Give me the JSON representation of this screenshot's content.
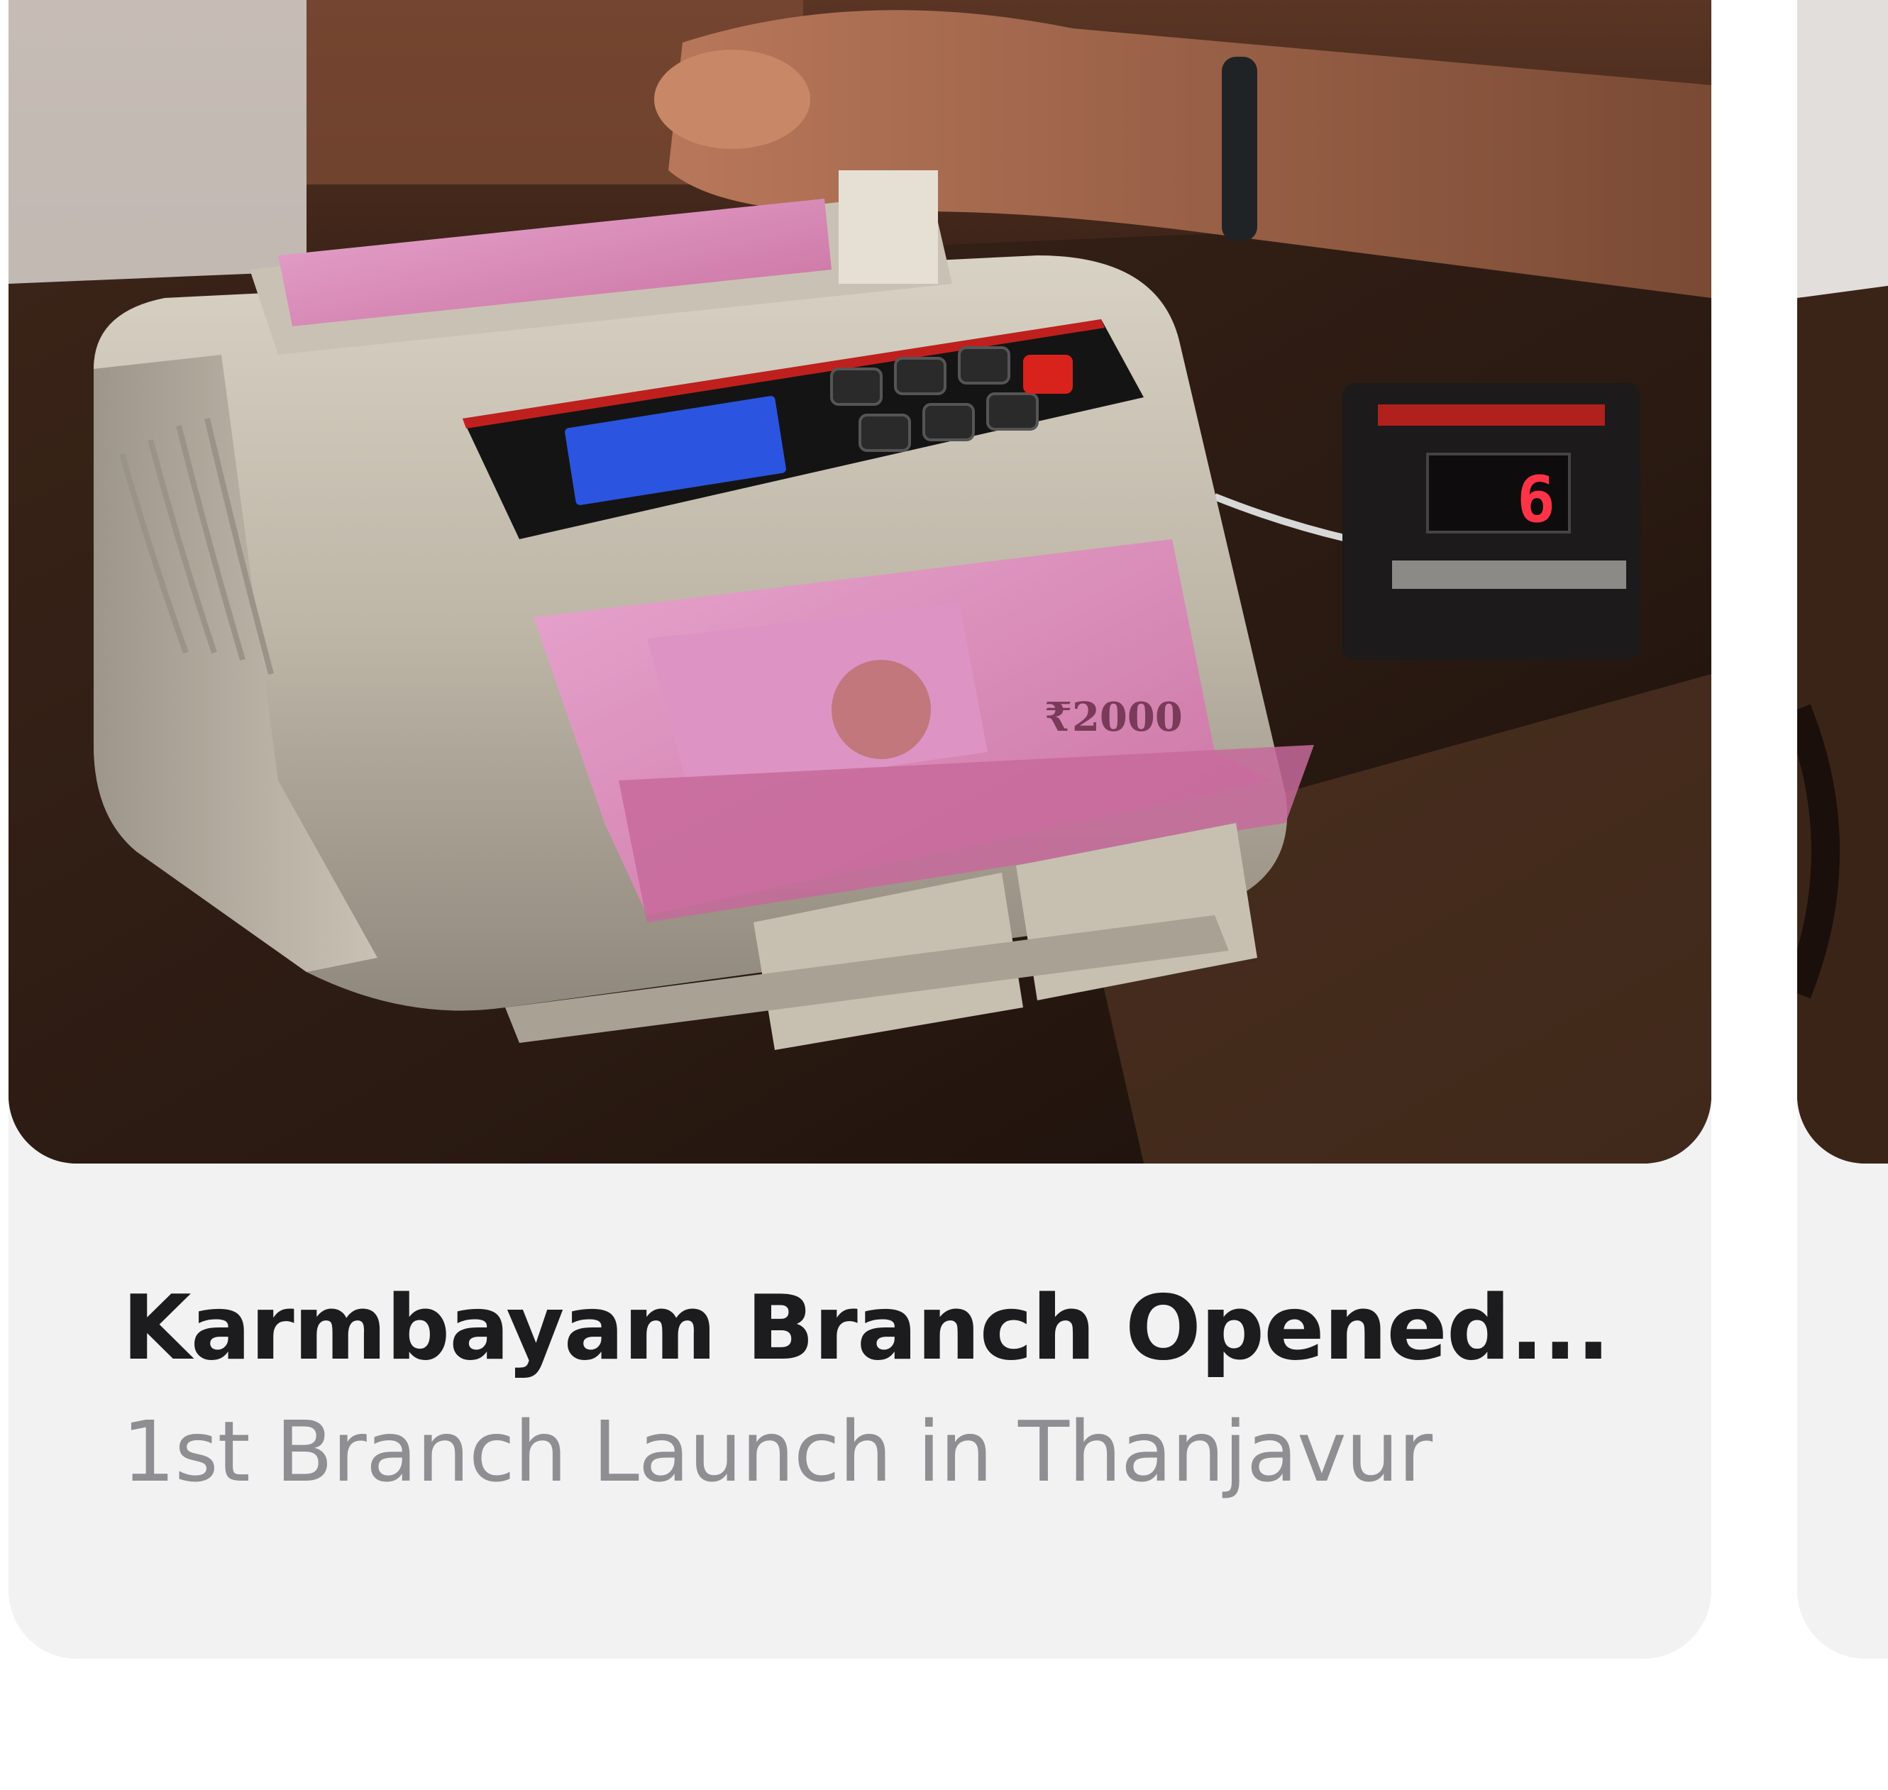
{
  "cards": [
    {
      "title": "Karmbayam Branch Opened...",
      "subtitle": "1st Branch Launch in Thanjavur",
      "photo": {
        "subject": "note-counting-machine",
        "display_digit": "6",
        "note_label": "₹2000"
      }
    }
  ],
  "colors": {
    "card_background": "#f2f2f2",
    "title": "#1c1c1e",
    "subtitle": "#8e8e93",
    "page_background": "#ffffff"
  }
}
